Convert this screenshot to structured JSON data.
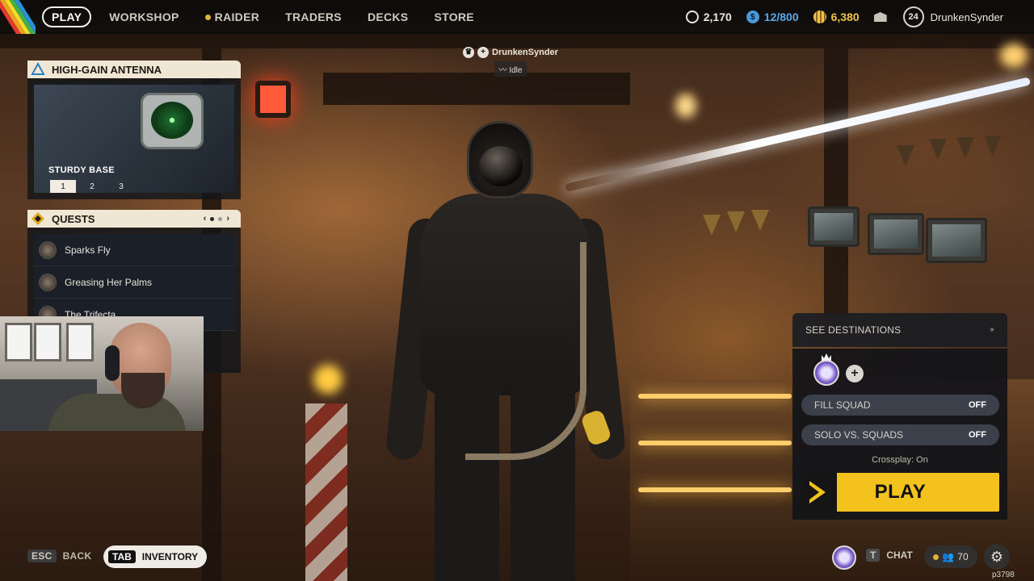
{
  "nav": {
    "items": [
      {
        "label": "PLAY",
        "active": true
      },
      {
        "label": "WORKSHOP"
      },
      {
        "label": "RAIDER",
        "dot": true
      },
      {
        "label": "TRADERS"
      },
      {
        "label": "DECKS"
      },
      {
        "label": "STORE"
      }
    ]
  },
  "currencies": {
    "coins": "2,170",
    "capacity": "12/800",
    "credits": "6,380"
  },
  "profile": {
    "level": "24",
    "name": "DrunkenSynder"
  },
  "player_tag": {
    "name": "DrunkenSynder",
    "status": "Idle"
  },
  "antenna": {
    "title": "HIGH-GAIN ANTENNA",
    "subtitle": "STURDY BASE",
    "tiers": [
      "1",
      "2",
      "3"
    ],
    "active_tier": "1"
  },
  "quests": {
    "title": "QUESTS",
    "items": [
      "Sparks Fly",
      "Greasing Her Palms",
      "The Trifecta"
    ]
  },
  "play_panel": {
    "see_destinations": "SEE DESTINATIONS",
    "fill_squad_label": "FILL SQUAD",
    "fill_squad_value": "OFF",
    "solo_label": "SOLO VS. SQUADS",
    "solo_value": "OFF",
    "crossplay": "Crossplay: On",
    "play_label": "PLAY",
    "accent": "#f4c21d"
  },
  "bottom": {
    "esc_key": "ESC",
    "back_label": "BACK",
    "tab_key": "TAB",
    "inventory_label": "INVENTORY",
    "chat_key": "T",
    "chat_label": "CHAT",
    "friends_count": "70",
    "build": "p3798"
  }
}
